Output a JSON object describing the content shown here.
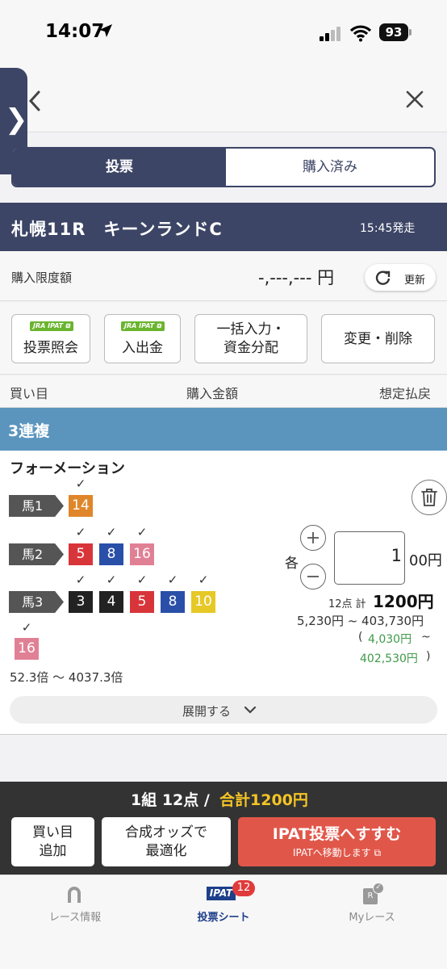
{
  "status_bar": {
    "time": "14:07",
    "battery": "93"
  },
  "segmented": {
    "vote": "投票",
    "bought": "購入済み"
  },
  "race": {
    "title": "札幌11R　キーンランドC",
    "start": "15:45発走"
  },
  "limit": {
    "label": "購入限度額",
    "value": "-,---,--- 円",
    "refresh": "更新"
  },
  "actions": {
    "jra_badge": "JRA IPAT",
    "inquiry": "投票照会",
    "deposit": "入出金",
    "bulk_line1": "一括入力・",
    "bulk_line2": "資金分配",
    "modify": "変更・削除"
  },
  "columns": {
    "buy": "買い目",
    "amount": "購入金額",
    "payout": "想定払戻"
  },
  "bet": {
    "type": "3連複",
    "method": "フォーメーション",
    "rows": [
      {
        "label": "馬1",
        "numbers": [
          "14"
        ]
      },
      {
        "label": "馬2",
        "numbers": [
          "5",
          "8",
          "16"
        ]
      },
      {
        "label": "馬3",
        "numbers": [
          "3",
          "4",
          "5",
          "8",
          "10",
          "16"
        ]
      }
    ],
    "check": "✓",
    "odds_range": "52.3倍 〜 4037.3倍",
    "expand": "展開する",
    "each": "各",
    "amount": "1",
    "amount_unit": "00円",
    "count_total": "12点 計",
    "total": "1200円",
    "payout_range": "5,230円 ~ 403,730円",
    "paren_open": "(",
    "payout_min": "4,030円",
    "tilde": "~",
    "payout_max": "402,530円",
    "paren_close": ")"
  },
  "colors": {
    "frame_1": "#222222",
    "frame_3": "#d8353a",
    "frame_4": "#2a4fa8",
    "frame_5": "#e6c826",
    "frame_7": "#e0862a",
    "frame_8": "#e08095",
    "accent_navy": "#3d4566",
    "bet_type_blue": "#5b95be",
    "ipat_red": "#e0574a",
    "total_yellow": "#f5c425"
  },
  "summary": {
    "count": "1組 12点 /",
    "total": "合計1200円",
    "add_line1": "買い目",
    "add_line2": "追加",
    "opt_line1": "合成オッズで",
    "opt_line2": "最適化",
    "ipat_title": "IPAT投票へすすむ",
    "ipat_sub": "IPATへ移動します"
  },
  "tabs": {
    "race_info": "レース情報",
    "ticket": "投票シート",
    "ticket_badge": "12",
    "ipat_icon": "IPAT",
    "my_race": "Myレース",
    "my_race_icon": "R"
  },
  "icons": {
    "navigation": "location-arrow-icon",
    "signal": "cellular-signal-icon",
    "wifi": "wifi-icon",
    "back": "chevron-left-icon",
    "close": "close-icon",
    "refresh": "refresh-icon",
    "external": "external-link-icon",
    "trash": "trash-icon",
    "plus": "plus-icon",
    "minus": "minus-icon",
    "expand": "chevron-down-icon",
    "race_info": "horseshoe-icon",
    "my_race": "my-race-icon"
  }
}
